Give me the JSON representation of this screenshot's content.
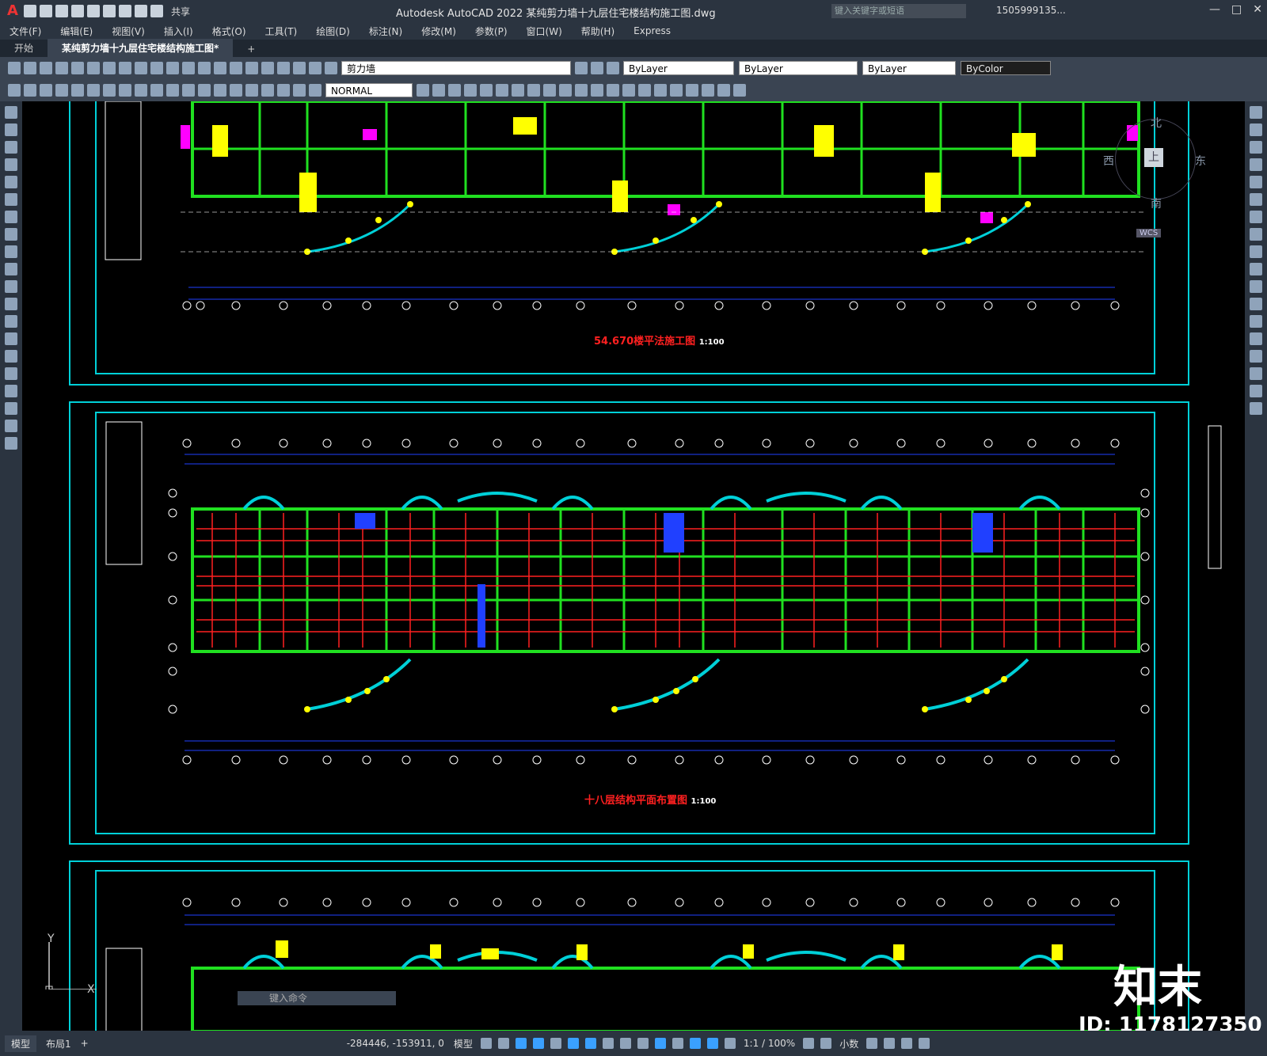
{
  "app": {
    "title": "Autodesk AutoCAD 2022    某纯剪力墙十九层住宅楼结构施工图.dwg",
    "logo": "A",
    "share": "共享",
    "search_placeholder": "键入关键字或短语",
    "user": "1505999135...",
    "window_buttons": [
      "—",
      "□",
      "✕"
    ]
  },
  "menu": [
    "文件(F)",
    "编辑(E)",
    "视图(V)",
    "插入(I)",
    "格式(O)",
    "工具(T)",
    "绘图(D)",
    "标注(N)",
    "修改(M)",
    "参数(P)",
    "窗口(W)",
    "帮助(H)",
    "Express"
  ],
  "tabs": [
    {
      "label": "开始"
    },
    {
      "label": "某纯剪力墙十九层住宅楼结构施工图*"
    },
    {
      "label": "+"
    }
  ],
  "toolbar": {
    "layer": "剪力墙",
    "color": "ByLayer",
    "linetype": "ByLayer",
    "lineweight": "ByLayer",
    "plotstyle": "ByColor",
    "style": "NORMAL"
  },
  "drawing": {
    "plan1_title": "54.670楼平法施工图",
    "plan1_scale": "1:100",
    "plan2_title": "十八层结构平面布置图",
    "plan2_scale": "1:100"
  },
  "compass": {
    "n": "北",
    "w": "西",
    "e": "东",
    "s": "南",
    "center": "上",
    "wcs": "WCS"
  },
  "command_placeholder": "键入命令",
  "ucs": {
    "y": "Y",
    "x": "X"
  },
  "watermark": {
    "brand": "知末",
    "id": "ID: 1178127350"
  },
  "status": {
    "layout_tabs": [
      "模型",
      "布局1",
      "+"
    ],
    "coords": "-284446, -153911, 0",
    "mode": "模型",
    "scale": "1:1 / 100%",
    "units": "小数"
  },
  "colors": {
    "frame": "#00d0d8",
    "wall": "#20e020",
    "beam": "#ff2020",
    "text_yellow": "#ffff00",
    "text_magenta": "#ff00ff",
    "axis_blue": "#2040ff"
  }
}
